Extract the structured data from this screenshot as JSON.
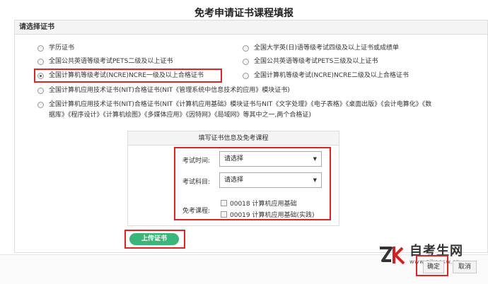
{
  "page": {
    "title": "免考申请证书课程填报"
  },
  "cert_panel": {
    "header": "请选择证书",
    "options": [
      {
        "label": "学历证书",
        "checked": false
      },
      {
        "label": "全国大学英(日)语等级考试四级及以上证书或成绩单",
        "checked": false
      },
      {
        "label": "全国公共英语等级考试PETS二级及以上证书",
        "checked": false
      },
      {
        "label": "全国公共英语等级考试PETS三级及以上证书",
        "checked": false
      },
      {
        "label": "全国计算机等级考试(NCRE)NCRE一级及以上合格证书",
        "checked": true
      },
      {
        "label": "全国计算机等级考试(NCRE)NCRE二级及以上合格证书",
        "checked": false
      },
      {
        "label": "全国计算机应用技术证书(NIT)合格证书(NIT《管理系统中信息技术的应用》模块证书)",
        "checked": false
      },
      {
        "label": "全国计算机应用技术证书(NIT)合格证书(NIT《计算机应用基础》模块证书与NIT《文字处理》《电子表格》《桌面出版》《会计电算化》《数据库》《程序设计》《计算机绘图》《多媒体应用》《因特网》《局域网》等其中之一,两个合格证)",
        "checked": false
      }
    ]
  },
  "info_box": {
    "header": "填写证书信息及免考课程",
    "exam_time_label": "考试时间:",
    "exam_time_value": "请选择",
    "exam_subject_label": "考试科目:",
    "exam_subject_value": "请选择",
    "exempt_label": "免考课程:",
    "courses": [
      {
        "label": "00018 计算机应用基础",
        "checked": false
      },
      {
        "label": "00019 计算机应用基础(实践)",
        "checked": false
      }
    ]
  },
  "upload_button": "上传证书",
  "footer": {
    "confirm": "确定",
    "cancel": "取消"
  },
  "watermark": {
    "brand": "自考生网",
    "url": "www.zikaosw.cn"
  },
  "colors": {
    "highlight": "#e02424",
    "upload": "#3bb57a"
  }
}
